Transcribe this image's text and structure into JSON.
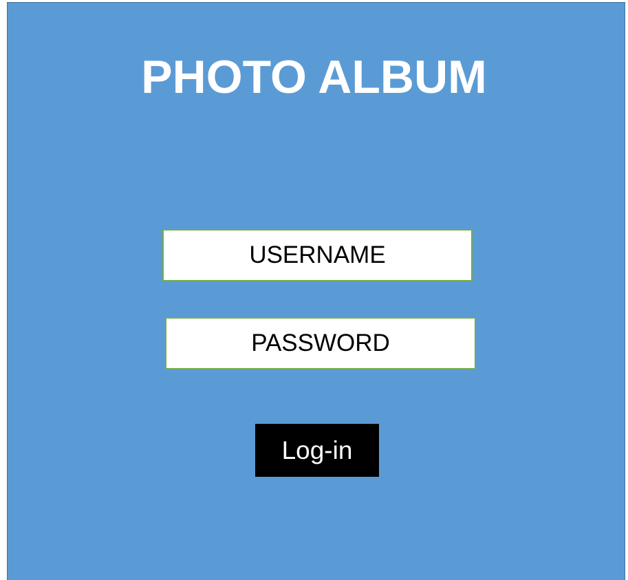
{
  "app": {
    "title": "PHOTO ALBUM"
  },
  "login_form": {
    "username_placeholder": "USERNAME",
    "password_placeholder": "PASSWORD",
    "login_label": "Log-in"
  },
  "colors": {
    "background": "#5b9bd5",
    "field_border": "#70ad47",
    "button_background": "#000000"
  }
}
